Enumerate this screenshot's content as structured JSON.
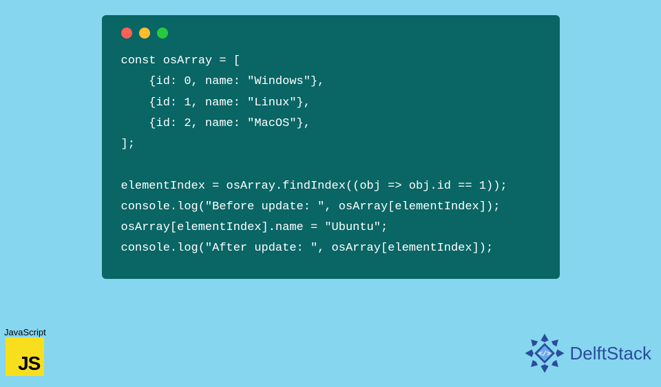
{
  "code_lines": [
    "const osArray = [",
    "    {id: 0, name: \"Windows\"},",
    "    {id: 1, name: \"Linux\"},",
    "    {id: 2, name: \"MacOS\"},",
    "];",
    "",
    "elementIndex = osArray.findIndex((obj => obj.id == 1));",
    "console.log(\"Before update: \", osArray[elementIndex]);",
    "osArray[elementIndex].name = \"Ubuntu\";",
    "console.log(\"After update: \", osArray[elementIndex]);"
  ],
  "js_badge": {
    "label": "JavaScript",
    "logo_text": "JS"
  },
  "brand": {
    "name": "DelftStack"
  },
  "window_dots": [
    "#ff5f56",
    "#ffbd2e",
    "#27c93f"
  ]
}
